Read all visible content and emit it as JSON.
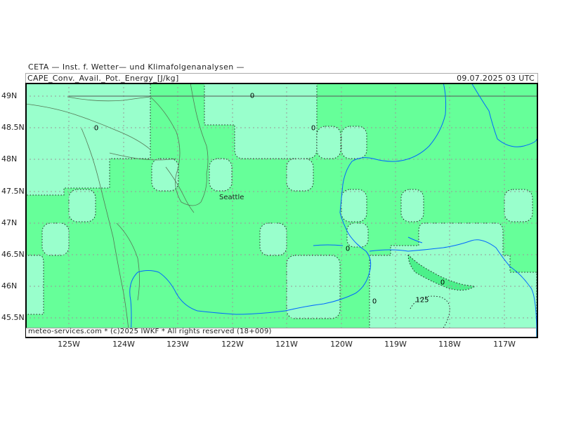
{
  "header": {
    "institute": "CETA — Inst. f. Wetter— und Klimafolgenanalysen —",
    "parameter": "CAPE_Conv._Avail._Pot._Energy_[J/kg]",
    "datetime": "09.07.2025 03 UTC"
  },
  "footer": {
    "credit": "meteo-services.com * (c)2025 IWKF * All rights reserved (18+009)"
  },
  "colors": {
    "low_fill": "#66ff99",
    "zero_fill": "#99ffcc",
    "mid_fill": "#33e67a",
    "water": "#0066ff",
    "coast": "#556655",
    "grid": "#888888"
  },
  "axes": {
    "lat_labels": [
      "49N",
      "48.5N",
      "48N",
      "47.5N",
      "47N",
      "46.5N",
      "46N",
      "45.5N"
    ],
    "lon_labels": [
      "125W",
      "124W",
      "123W",
      "122W",
      "121W",
      "120W",
      "119W",
      "118W",
      "117W"
    ]
  },
  "cities": {
    "seattle": "Seattle"
  },
  "contour_labels": {
    "z1": "0",
    "z2": "0",
    "z3": "0",
    "z4": "0",
    "z5": "0",
    "z6": "0",
    "z7": "125"
  }
}
